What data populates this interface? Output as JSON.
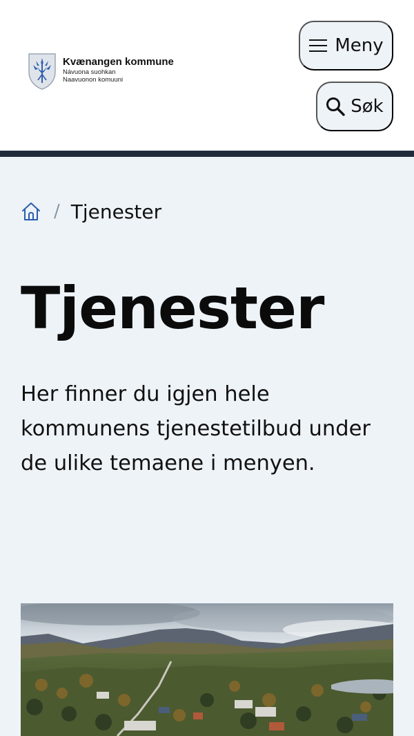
{
  "header": {
    "logo": {
      "name": "Kvænangen kommune",
      "sub1": "Návuona suohkan",
      "sub2": "Naavuonon komuuni",
      "icon": "crest-icon"
    },
    "menu_button": {
      "label": "Meny",
      "icon": "hamburger-icon"
    },
    "search_button": {
      "label": "Søk",
      "icon": "search-icon"
    }
  },
  "breadcrumb": {
    "home_icon": "home-icon",
    "separator": "/",
    "current": "Tjenester"
  },
  "main": {
    "title": "Tjenester",
    "intro": "Her finner du igjen hele kommunens tjenestetilbud under de ulike temaene i menyen."
  },
  "colors": {
    "background": "#eef3f8",
    "header_bg": "#ffffff",
    "header_rule": "#1f2a3a",
    "accent": "#2a5db0"
  }
}
